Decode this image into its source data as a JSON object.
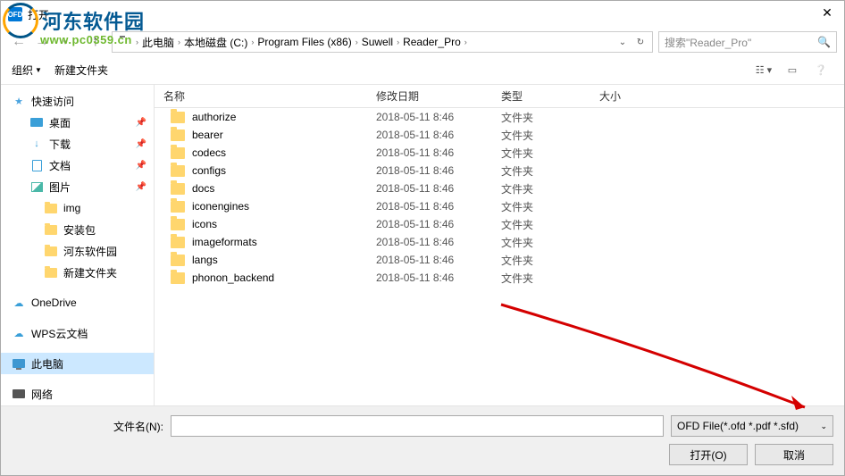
{
  "window": {
    "title": "打开"
  },
  "watermark": {
    "name": "河东软件园",
    "url": "www.pc0359.cn"
  },
  "breadcrumb": {
    "items": [
      "此电脑",
      "本地磁盘 (C:)",
      "Program Files (x86)",
      "Suwell",
      "Reader_Pro"
    ]
  },
  "search": {
    "placeholder": "搜索\"Reader_Pro\""
  },
  "toolbar": {
    "organize": "组织",
    "newfolder": "新建文件夹"
  },
  "sidebar": {
    "quick": "快速访问",
    "desktop": "桌面",
    "downloads": "下载",
    "documents": "文档",
    "pictures": "图片",
    "img": "img",
    "install": "安装包",
    "hedong": "河东软件园",
    "newfolder": "新建文件夹",
    "onedrive": "OneDrive",
    "wps": "WPS云文档",
    "thispc": "此电脑",
    "network": "网络"
  },
  "columns": {
    "name": "名称",
    "date": "修改日期",
    "type": "类型",
    "size": "大小"
  },
  "files": [
    {
      "name": "authorize",
      "date": "2018-05-11 8:46",
      "type": "文件夹"
    },
    {
      "name": "bearer",
      "date": "2018-05-11 8:46",
      "type": "文件夹"
    },
    {
      "name": "codecs",
      "date": "2018-05-11 8:46",
      "type": "文件夹"
    },
    {
      "name": "configs",
      "date": "2018-05-11 8:46",
      "type": "文件夹"
    },
    {
      "name": "docs",
      "date": "2018-05-11 8:46",
      "type": "文件夹"
    },
    {
      "name": "iconengines",
      "date": "2018-05-11 8:46",
      "type": "文件夹"
    },
    {
      "name": "icons",
      "date": "2018-05-11 8:46",
      "type": "文件夹"
    },
    {
      "name": "imageformats",
      "date": "2018-05-11 8:46",
      "type": "文件夹"
    },
    {
      "name": "langs",
      "date": "2018-05-11 8:46",
      "type": "文件夹"
    },
    {
      "name": "phonon_backend",
      "date": "2018-05-11 8:46",
      "type": "文件夹"
    }
  ],
  "footer": {
    "filename_label": "文件名(N):",
    "filename_value": "",
    "filter": "OFD File(*.ofd *.pdf *.sfd)",
    "open": "打开(O)",
    "cancel": "取消"
  }
}
